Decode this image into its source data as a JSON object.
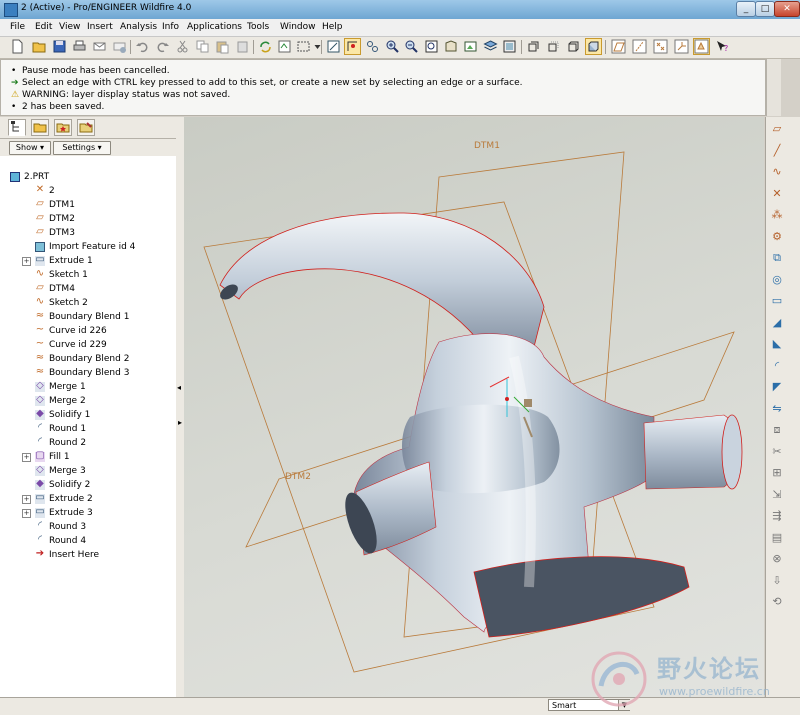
{
  "window": {
    "title": "2 (Active) - Pro/ENGINEER Wildfire 4.0",
    "min": "_",
    "max": "□",
    "close": "✕"
  },
  "menu": [
    "File",
    "Edit",
    "View",
    "Insert",
    "Analysis",
    "Info",
    "Applications",
    "Tools",
    "Window",
    "Help"
  ],
  "toolbar_icons": [
    "new-icon",
    "open-icon",
    "save-icon",
    "print-icon",
    "email-icon",
    "email-link-icon",
    "undo-icon",
    "redo-icon",
    "cut-icon",
    "copy-icon",
    "paste-icon",
    "paste-special-icon",
    "regenerate-icon",
    "regen-manager-icon",
    "find-icon",
    "select-box-icon",
    "dropdown-icon",
    "repaint-icon",
    "spin-center-icon",
    "orient-mode-icon",
    "zoom-in-icon",
    "zoom-out-icon",
    "refit-icon",
    "reorient-icon",
    "saved-views-icon",
    "layers-icon",
    "view-manager-icon",
    "wireframe-icon",
    "hidden-line-icon",
    "no-hidden-icon",
    "shading-icon",
    "datum-planes-icon",
    "datum-axes-icon",
    "datum-points-icon",
    "csys-icon",
    "annotation-icon",
    "context-help-icon"
  ],
  "messages": [
    {
      "icon": "bullet",
      "text": "Pause mode has been cancelled."
    },
    {
      "icon": "arrow",
      "text": "Select an edge with CTRL key pressed to add to this set, or create a new set by selecting an edge or a surface."
    },
    {
      "icon": "warning",
      "text": "WARNING: layer display status was not saved."
    },
    {
      "icon": "bullet",
      "text": "2 has been saved."
    }
  ],
  "navigator": {
    "tabs": [
      "model-tree-tab",
      "folder-browser-tab",
      "favorites-tab",
      "connections-tab"
    ],
    "show_label": "Show ▾",
    "settings_label": "Settings ▾"
  },
  "tree": [
    {
      "label": "2.PRT",
      "icon": "part",
      "indent": 0,
      "expand": false
    },
    {
      "label": "2",
      "icon": "csys",
      "indent": 1,
      "expand": false
    },
    {
      "label": "DTM1",
      "icon": "plane",
      "indent": 1,
      "expand": false
    },
    {
      "label": "DTM2",
      "icon": "plane",
      "indent": 1,
      "expand": false
    },
    {
      "label": "DTM3",
      "icon": "plane",
      "indent": 1,
      "expand": false
    },
    {
      "label": "Import Feature id 4",
      "icon": "import",
      "indent": 1,
      "expand": false
    },
    {
      "label": "Extrude 1",
      "icon": "extrude",
      "indent": 1,
      "expand": true
    },
    {
      "label": "Sketch 1",
      "icon": "sketch",
      "indent": 1,
      "expand": false
    },
    {
      "label": "DTM4",
      "icon": "plane",
      "indent": 1,
      "expand": false
    },
    {
      "label": "Sketch 2",
      "icon": "sketch",
      "indent": 1,
      "expand": false
    },
    {
      "label": "Boundary Blend 1",
      "icon": "blend",
      "indent": 1,
      "expand": false
    },
    {
      "label": "Curve id 226",
      "icon": "curve",
      "indent": 1,
      "expand": false
    },
    {
      "label": "Curve id 229",
      "icon": "curve",
      "indent": 1,
      "expand": false
    },
    {
      "label": "Boundary Blend 2",
      "icon": "blend",
      "indent": 1,
      "expand": false
    },
    {
      "label": "Boundary Blend 3",
      "icon": "blend",
      "indent": 1,
      "expand": false
    },
    {
      "label": "Merge 1",
      "icon": "merge",
      "indent": 1,
      "expand": false
    },
    {
      "label": "Merge 2",
      "icon": "merge",
      "indent": 1,
      "expand": false
    },
    {
      "label": "Solidify 1",
      "icon": "solidify",
      "indent": 1,
      "expand": false
    },
    {
      "label": "Round 1",
      "icon": "round",
      "indent": 1,
      "expand": false
    },
    {
      "label": "Round 2",
      "icon": "round",
      "indent": 1,
      "expand": false
    },
    {
      "label": "Fill 1",
      "icon": "fill",
      "indent": 1,
      "expand": true
    },
    {
      "label": "Merge 3",
      "icon": "merge",
      "indent": 1,
      "expand": false
    },
    {
      "label": "Solidify 2",
      "icon": "solidify",
      "indent": 1,
      "expand": false
    },
    {
      "label": "Extrude 2",
      "icon": "extrude",
      "indent": 1,
      "expand": true
    },
    {
      "label": "Extrude 3",
      "icon": "extrude",
      "indent": 1,
      "expand": true
    },
    {
      "label": "Round 3",
      "icon": "round",
      "indent": 1,
      "expand": false
    },
    {
      "label": "Round 4",
      "icon": "round",
      "indent": 1,
      "expand": false
    },
    {
      "label": "Insert Here",
      "icon": "insert",
      "indent": 1,
      "expand": false
    }
  ],
  "viewport": {
    "datum_labels": [
      "DTM1",
      "DTM2"
    ]
  },
  "right_toolbar_icons": [
    "datum-plane-icon",
    "datum-axis-icon",
    "datum-curve-icon",
    "datum-point-icon",
    "csys-icon",
    "analysis-icon",
    "sketch-icon",
    "hole-icon",
    "shell-icon",
    "rib-icon",
    "draft-icon",
    "round-icon",
    "chamfer-icon",
    "mirror-icon",
    "merge-icon",
    "trim-icon",
    "pattern-icon",
    "extend-icon",
    "offset-icon",
    "thicken-icon",
    "intersect-icon",
    "project-icon",
    "wrap-icon"
  ],
  "status": {
    "filter_value": "Smart"
  },
  "watermark": {
    "text": "野火论坛",
    "url": "www.proewildfire.cn"
  },
  "colors": {
    "datum": "#b97a3a",
    "edge_highlight": "#d0201c",
    "model_light": "#e9eef3",
    "model_dark": "#6b7886"
  }
}
